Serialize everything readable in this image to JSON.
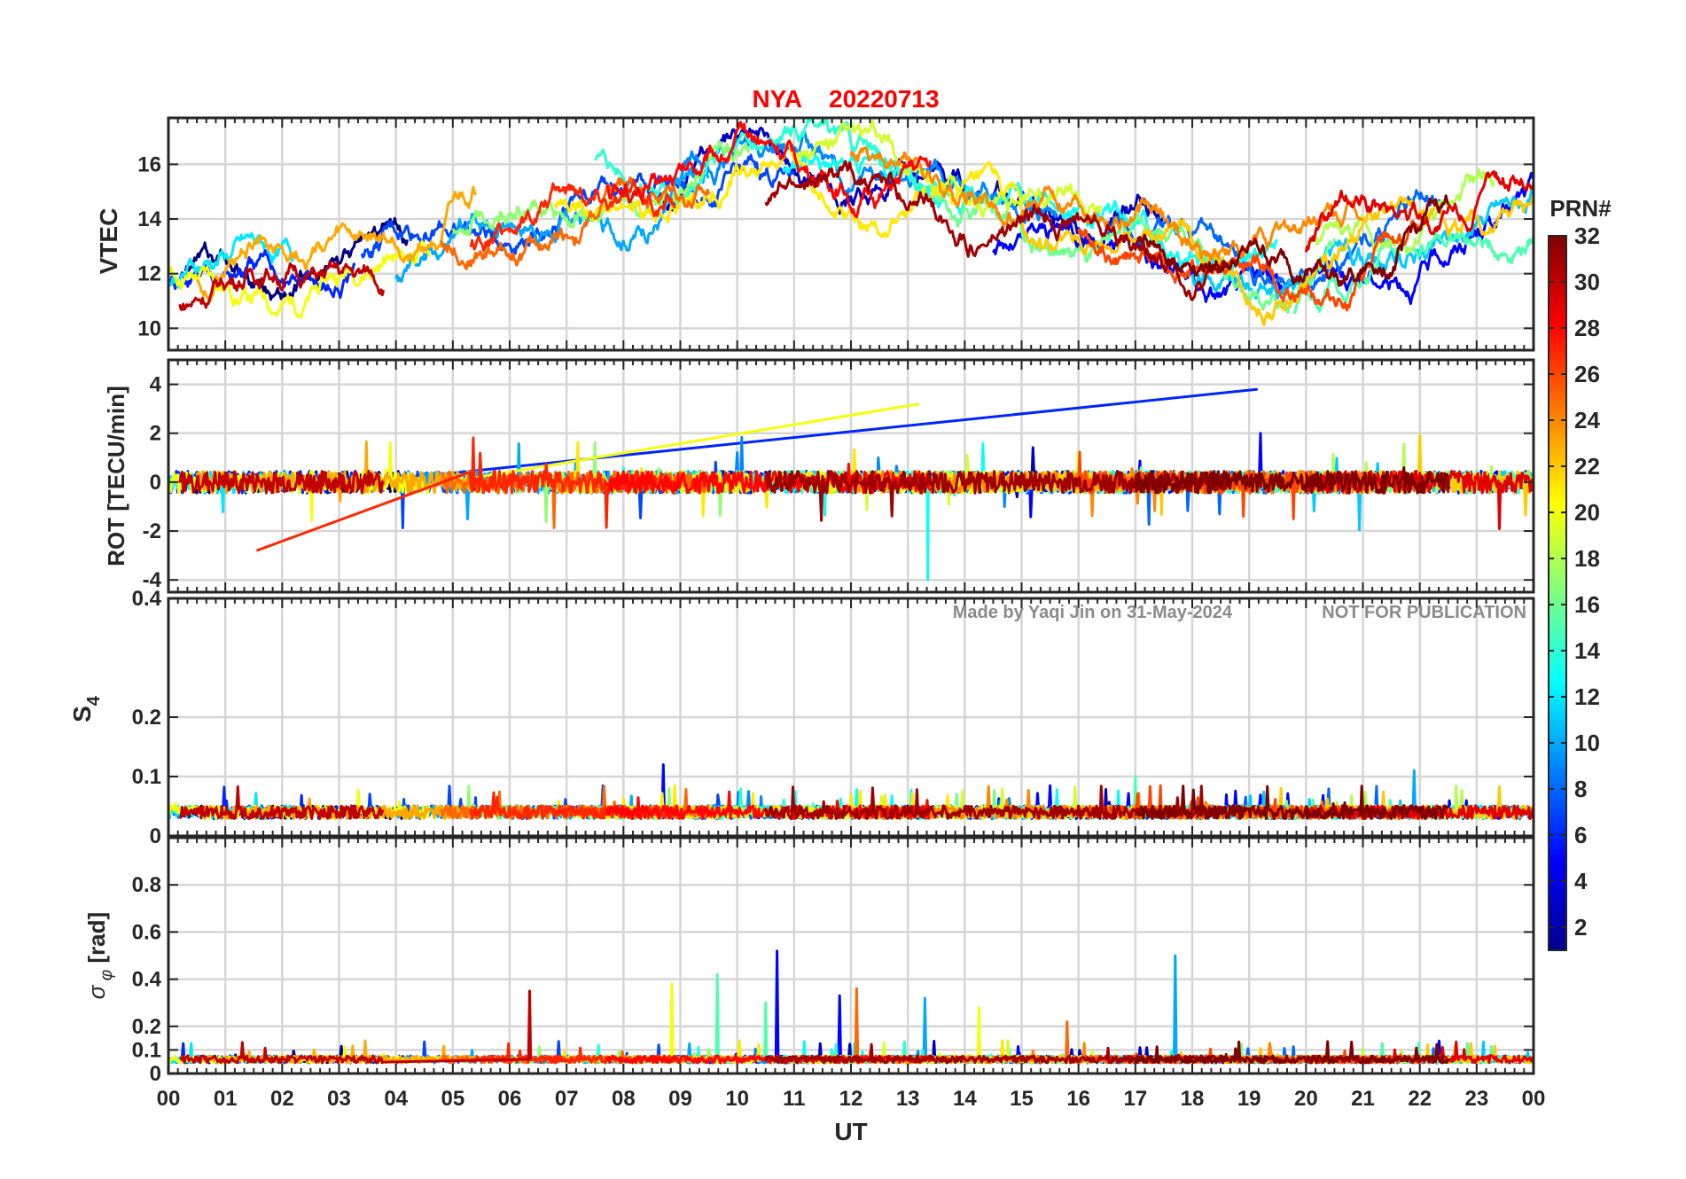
{
  "chart_data": {
    "type": "line",
    "title": {
      "station": "NYA",
      "date": "20220713",
      "color": "#ff0000"
    },
    "watermark": {
      "author": "Made by Yaqi Jin on 31-May-2024",
      "notice": "NOT FOR PUBLICATION"
    },
    "xlabel": "UT",
    "x_range_hours": [
      0,
      24
    ],
    "x_ticks": [
      "00",
      "01",
      "02",
      "03",
      "04",
      "05",
      "06",
      "07",
      "08",
      "09",
      "10",
      "11",
      "12",
      "13",
      "14",
      "15",
      "16",
      "17",
      "18",
      "19",
      "20",
      "21",
      "22",
      "23",
      "00"
    ],
    "grid": true,
    "panels": [
      {
        "id": "vtec",
        "ylabel": "VTEC",
        "ylim": [
          9.2,
          17.7
        ],
        "ticks": [
          {
            "v": 10,
            "label": "10"
          },
          {
            "v": 12,
            "label": "12"
          },
          {
            "v": 14,
            "label": "14"
          },
          {
            "v": 16,
            "label": "16"
          }
        ],
        "trend": {
          "t": [
            0,
            2,
            4,
            6,
            8,
            10,
            11,
            13,
            15,
            17,
            18.5,
            19.5,
            21,
            22.5,
            24
          ],
          "v": [
            12.0,
            12.3,
            13.0,
            14.2,
            15.0,
            15.8,
            15.6,
            15.0,
            14.0,
            13.6,
            12.6,
            11.8,
            12.8,
            14.0,
            14.8
          ]
        },
        "sample": [
          {
            "hour": 0,
            "value": 12.8
          },
          {
            "hour": 10,
            "value": 15.8
          },
          {
            "hour": 19,
            "value": 11.8
          }
        ]
      },
      {
        "id": "rot",
        "ylabel": "ROT [TECU/min]",
        "ylim": [
          -4.5,
          5.0
        ],
        "ticks": [
          {
            "v": -4,
            "label": "-4"
          },
          {
            "v": -2,
            "label": "-2"
          },
          {
            "v": 0,
            "label": "0"
          },
          {
            "v": 2,
            "label": "2"
          },
          {
            "v": 4,
            "label": "4"
          }
        ],
        "extremes": [
          {
            "hour": 19.15,
            "value": 3.8
          },
          {
            "hour": 13.35,
            "value": -4.0
          },
          {
            "hour": 13.2,
            "value": 3.2
          },
          {
            "hour": 1.55,
            "value": -2.8
          }
        ]
      },
      {
        "id": "s4",
        "ylabel": "S4",
        "ylim": [
          0,
          0.4
        ],
        "ticks": [
          {
            "v": 0,
            "label": "0"
          },
          {
            "v": 0.1,
            "label": "0.1"
          },
          {
            "v": 0.2,
            "label": "0.2"
          },
          {
            "v": 0.4,
            "label": "0.4"
          }
        ],
        "baseline": 0.04,
        "peaks": [
          {
            "hour": 8.7,
            "value": 0.12
          },
          {
            "hour": 21.9,
            "value": 0.11
          },
          {
            "hour": 17.0,
            "value": 0.1
          }
        ]
      },
      {
        "id": "sigma_phi",
        "ylabel": "σφ [rad]",
        "ylim": [
          0,
          1.0
        ],
        "ticks": [
          {
            "v": 0,
            "label": "0"
          },
          {
            "v": 0.1,
            "label": "0.1"
          },
          {
            "v": 0.2,
            "label": "0.2"
          },
          {
            "v": 0.4,
            "label": "0.4"
          },
          {
            "v": 0.6,
            "label": "0.6"
          },
          {
            "v": 0.8,
            "label": "0.8"
          }
        ],
        "baseline": 0.06,
        "peaks": [
          {
            "hour": 10.7,
            "value": 0.52
          },
          {
            "hour": 17.7,
            "value": 0.5
          },
          {
            "hour": 9.65,
            "value": 0.42
          },
          {
            "hour": 8.85,
            "value": 0.38
          },
          {
            "hour": 12.1,
            "value": 0.36
          },
          {
            "hour": 6.35,
            "value": 0.35
          },
          {
            "hour": 11.8,
            "value": 0.33
          },
          {
            "hour": 13.3,
            "value": 0.32
          },
          {
            "hour": 10.5,
            "value": 0.3
          },
          {
            "hour": 14.25,
            "value": 0.28
          },
          {
            "hour": 15.8,
            "value": 0.22
          }
        ]
      }
    ],
    "colorbar": {
      "label": "PRN#",
      "range": [
        1,
        32
      ],
      "ticks": [
        2,
        4,
        6,
        8,
        10,
        12,
        14,
        16,
        18,
        20,
        22,
        24,
        26,
        28,
        30,
        32
      ],
      "colormap": "jet"
    },
    "series": [
      {
        "prn": 1,
        "t0": 0.3,
        "t1": 4.2
      },
      {
        "prn": 3,
        "t0": 8.6,
        "t1": 17.5
      },
      {
        "prn": 5,
        "t0": 14.5,
        "t1": 24.0
      },
      {
        "prn": 6,
        "t0": 0.0,
        "t1": 3.3
      },
      {
        "prn": 7,
        "t0": 3.4,
        "t1": 11.0
      },
      {
        "prn": 8,
        "t0": 16.5,
        "t1": 22.4
      },
      {
        "prn": 9,
        "t0": 9.0,
        "t1": 15.6
      },
      {
        "prn": 10,
        "t0": 4.0,
        "t1": 9.5
      },
      {
        "prn": 11,
        "t0": 18.0,
        "t1": 24.0
      },
      {
        "prn": 12,
        "t0": 0.0,
        "t1": 2.2
      },
      {
        "prn": 13,
        "t0": 10.8,
        "t1": 19.5
      },
      {
        "prn": 14,
        "t0": 7.5,
        "t1": 13.8
      },
      {
        "prn": 15,
        "t0": 19.8,
        "t1": 24.0
      },
      {
        "prn": 16,
        "t0": 13.5,
        "t1": 20.5
      },
      {
        "prn": 17,
        "t0": 5.0,
        "t1": 10.2
      },
      {
        "prn": 18,
        "t0": 20.0,
        "t1": 23.3
      },
      {
        "prn": 19,
        "t0": 11.0,
        "t1": 16.4
      },
      {
        "prn": 20,
        "t0": 0.0,
        "t1": 4.6
      },
      {
        "prn": 21,
        "t0": 6.8,
        "t1": 15.0
      },
      {
        "prn": 22,
        "t0": 15.0,
        "t1": 24.0
      },
      {
        "prn": 23,
        "t0": 0.5,
        "t1": 5.4
      },
      {
        "prn": 24,
        "t0": 12.0,
        "t1": 21.0
      },
      {
        "prn": 25,
        "t0": 4.8,
        "t1": 9.5
      },
      {
        "prn": 26,
        "t0": 16.0,
        "t1": 22.0
      },
      {
        "prn": 27,
        "t0": 5.3,
        "t1": 8.9
      },
      {
        "prn": 28,
        "t0": 7.7,
        "t1": 13.4
      },
      {
        "prn": 29,
        "t0": 20.0,
        "t1": 24.0
      },
      {
        "prn": 30,
        "t0": 0.2,
        "t1": 3.8
      },
      {
        "prn": 31,
        "t0": 10.5,
        "t1": 18.6
      },
      {
        "prn": 32,
        "t0": 17.0,
        "t1": 22.5
      }
    ]
  }
}
